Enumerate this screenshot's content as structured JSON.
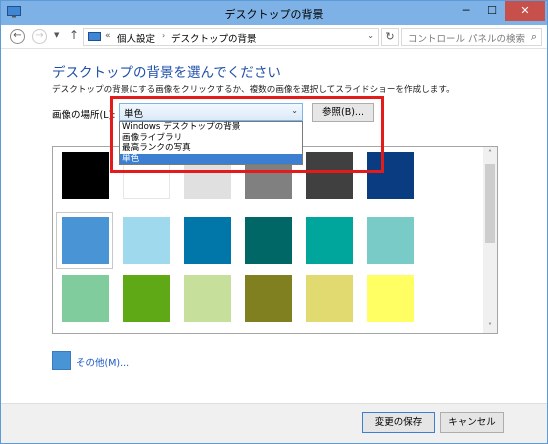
{
  "window": {
    "title": "デスクトップの背景",
    "minimize_glyph": "─",
    "maximize_glyph": "☐",
    "close_glyph": "✕",
    "titlebar_color": "#7eb2e6"
  },
  "nav": {
    "back_glyph": "←",
    "forward_glyph": "→",
    "recent_glyph": "▼",
    "up_glyph": "↑",
    "address_chevron": "«",
    "breadcrumbs": [
      "個人設定",
      "デスクトップの背景"
    ],
    "breadcrumb_sep": "›",
    "address_dropdown_glyph": "⌄",
    "refresh_glyph": "↻",
    "search_placeholder": "コントロール パネルの検索",
    "search_glyph": "⌕"
  },
  "content": {
    "title": "デスクトップの背景を選んでください",
    "description": "デスクトップの背景にする画像をクリックするか、複数の画像を選択してスライドショーを作成します。",
    "location_label": "画像の場所(L):",
    "location_value": "単色",
    "location_arrow": "⌄",
    "browse_label": "参照(B)...",
    "dropdown_options": [
      "Windows デスクトップの背景",
      "画像ライブラリ",
      "最高ランクの写真",
      "単色"
    ],
    "dropdown_selected_index": 3,
    "highlight_color": "#e41b1b"
  },
  "swatches": {
    "colors": [
      "#000000",
      "#ffffff",
      "#e0e0e0",
      "#808080",
      "#404040",
      "#0a3c82",
      "#4994d4",
      "#9fd9ee",
      "#0077a8",
      "#006666",
      "#00a69c",
      "#78cbc7",
      "#80cc9c",
      "#5fa816",
      "#c6e09c",
      "#808020",
      "#e0da70",
      "#ffff64"
    ],
    "selected_index": 6
  },
  "scrollbar": {
    "up_glyph": "˄",
    "down_glyph": "˅"
  },
  "other": {
    "label": "その他(M)...",
    "color": "#4994d4"
  },
  "footer": {
    "save_label": "変更の保存",
    "cancel_label": "キャンセル"
  }
}
